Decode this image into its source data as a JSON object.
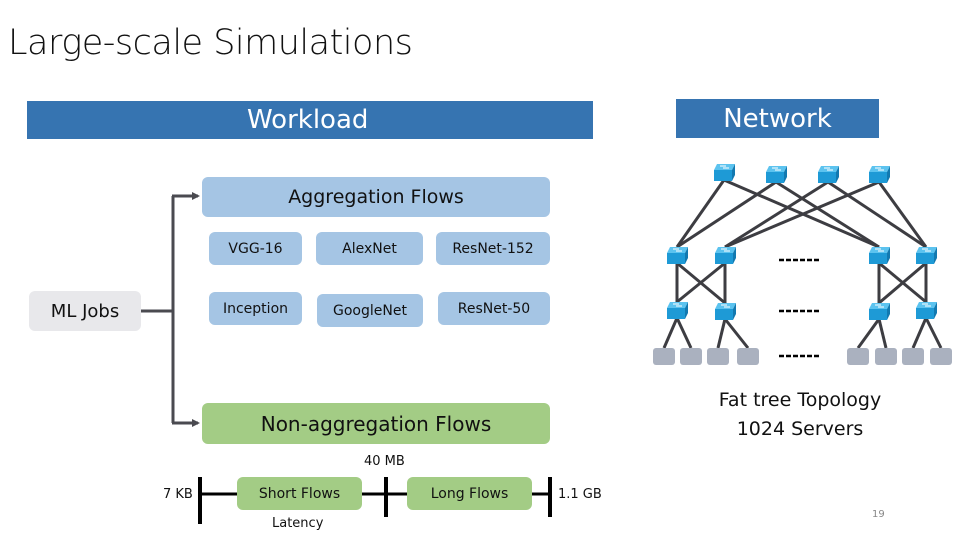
{
  "slide": {
    "title": "Large-scale Simulations",
    "page_number": "19"
  },
  "workload": {
    "header": "Workload",
    "source": "ML Jobs",
    "aggregation": {
      "label": "Aggregation Flows",
      "models": [
        "VGG-16",
        "AlexNet",
        "ResNet-152",
        "Inception",
        "GoogleNet",
        "ResNet-50"
      ]
    },
    "non_aggregation": {
      "label": "Non-aggregation Flows",
      "scale": {
        "min_label": "7 KB",
        "split_label": "40 MB",
        "max_label": "1.1 GB",
        "short_label": "Short Flows",
        "long_label": "Long Flows",
        "short_metric": "Latency"
      }
    }
  },
  "network": {
    "header": "Network",
    "topology_label": "Fat tree Topology",
    "servers_label": "1024 Servers",
    "ellipsis": "------",
    "icons": {
      "switch": "network-switch-icon",
      "server": "server-icon"
    }
  },
  "colors": {
    "header_blue": "#3674b1",
    "aggregation_blue": "#a5c5e4",
    "nonagg_green": "#a3cc85",
    "mljobs_gray": "#e8e8eb",
    "switch_blue": "#1e9ad6",
    "server_gray": "#aab1bf",
    "link": "#3d3d42"
  }
}
